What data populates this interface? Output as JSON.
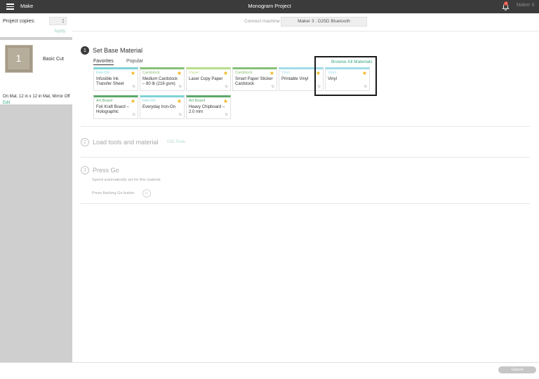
{
  "topbar": {
    "make_label": "Make",
    "project_title": "Monogram Project",
    "notification_count": "8",
    "machine_label": "Maker 3"
  },
  "left_panel": {
    "copies_label": "Project copies:",
    "apply_label": "Apply",
    "mat_number": "1",
    "cut_label": "Basic Cut",
    "mat_info": "On Mat, 12 in x 12 in Mat, Mirror Off",
    "edit_label": "Edit"
  },
  "connect": {
    "label": "Connect machine",
    "selected": "Maker 3 : D25D Bluetooth"
  },
  "steps": [
    {
      "number": "1",
      "title": "Set Base Material"
    },
    {
      "number": "2",
      "title": "Load tools and material"
    },
    {
      "number": "3",
      "title": "Press Go"
    }
  ],
  "materials": {
    "tabs": [
      "Favorites",
      "Popular"
    ],
    "browse_label": "Browse All Materials",
    "cards": [
      {
        "category": "Iron-On",
        "name": "Infusible Ink Transfer Sheet",
        "color": "#7fd3d6"
      },
      {
        "category": "Cardstock",
        "name": "Medium Cardstock – 80 lb (216 gsm)",
        "color": "#86c076"
      },
      {
        "category": "Paper",
        "name": "Laser Copy Paper",
        "color": "#b9de8a"
      },
      {
        "category": "Cardstock",
        "name": "Smart Paper Sticker Cardstock",
        "color": "#86c076"
      },
      {
        "category": "Vinyl",
        "name": "Printable Vinyl",
        "color": "#a0dce8"
      },
      {
        "category": "Vinyl",
        "name": "Vinyl",
        "color": "#a0dce8"
      },
      {
        "category": "Art Board",
        "name": "Foil Kraft Board – Holographic",
        "color": "#5aa86a"
      },
      {
        "category": "Iron-On",
        "name": "Everyday Iron-On",
        "color": "#7fd3d6"
      },
      {
        "category": "Art Board",
        "name": "Heavy Chipboard – 2.0 mm",
        "color": "#5aa86a"
      }
    ]
  },
  "step2": {
    "edit_tools_label": "Edit Tools"
  },
  "step3": {
    "speed_note": "Speed automatically set for this material.",
    "press_note": "Press flashing Go button."
  },
  "bottom": {
    "cancel_label": "Cancel"
  },
  "colors": {
    "accent": "#3aa784",
    "topbar": "#3b3b3b",
    "star": "#f2b313"
  }
}
